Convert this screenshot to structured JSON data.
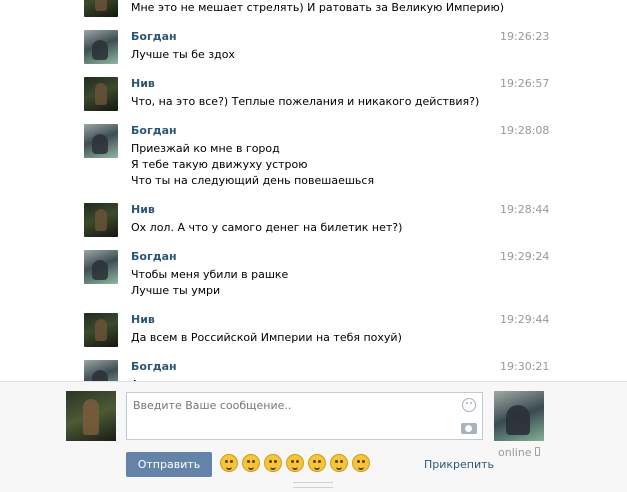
{
  "messages": [
    {
      "author": "",
      "time": "",
      "lines": [
        "Мне это не мешает стрелять) И ратовать за Великую Империю)"
      ],
      "avatar": "niv-avatar"
    },
    {
      "author": "Богдан",
      "time": "19:26:23",
      "lines": [
        "Лучше ты бе здох"
      ],
      "avatar": "bogdan-avatar"
    },
    {
      "author": "Нив",
      "time": "19:26:57",
      "lines": [
        "Что, на это все?) Теплые пожелания и никакого действия?)"
      ],
      "avatar": "niv-avatar"
    },
    {
      "author": "Богдан",
      "time": "19:28:08",
      "lines": [
        "Приезжай ко мне в город",
        "Я тебе такую движуху устрою",
        "Что ты на следующий день повешаешься"
      ],
      "avatar": "bogdan-avatar"
    },
    {
      "author": "Нив",
      "time": "19:28:44",
      "lines": [
        "Ох лол. А что у самого денег на билетик нет?)"
      ],
      "avatar": "niv-avatar"
    },
    {
      "author": "Богдан",
      "time": "19:29:24",
      "lines": [
        "Чтобы меня убили в рашке",
        "Лучше ты умри"
      ],
      "avatar": "bogdan-avatar"
    },
    {
      "author": "Нив",
      "time": "19:29:44",
      "lines": [
        "Да всем в Российской Империи на тебя похуй)"
      ],
      "avatar": "niv-avatar"
    },
    {
      "author": "Богдан",
      "time": "19:30:21",
      "lines": [
        "А"
      ],
      "avatar": "bogdan-avatar"
    }
  ],
  "composer": {
    "placeholder": "Введите Ваше сообщение..",
    "send_label": "Отправить",
    "attach_label": "Прикрепить",
    "emoji_icons": [
      "kiss-emoji-icon",
      "smile-emoji-icon",
      "laugh-emoji-icon",
      "grin-emoji-icon",
      "happy-emoji-icon",
      "wink-kiss-emoji-icon",
      "tongue-emoji-icon"
    ]
  },
  "peer": {
    "status": "online"
  },
  "colors": {
    "link": "#2b587a",
    "send_button": "#6383a8",
    "timestamp": "#999999",
    "emoji": "#f5c536"
  }
}
